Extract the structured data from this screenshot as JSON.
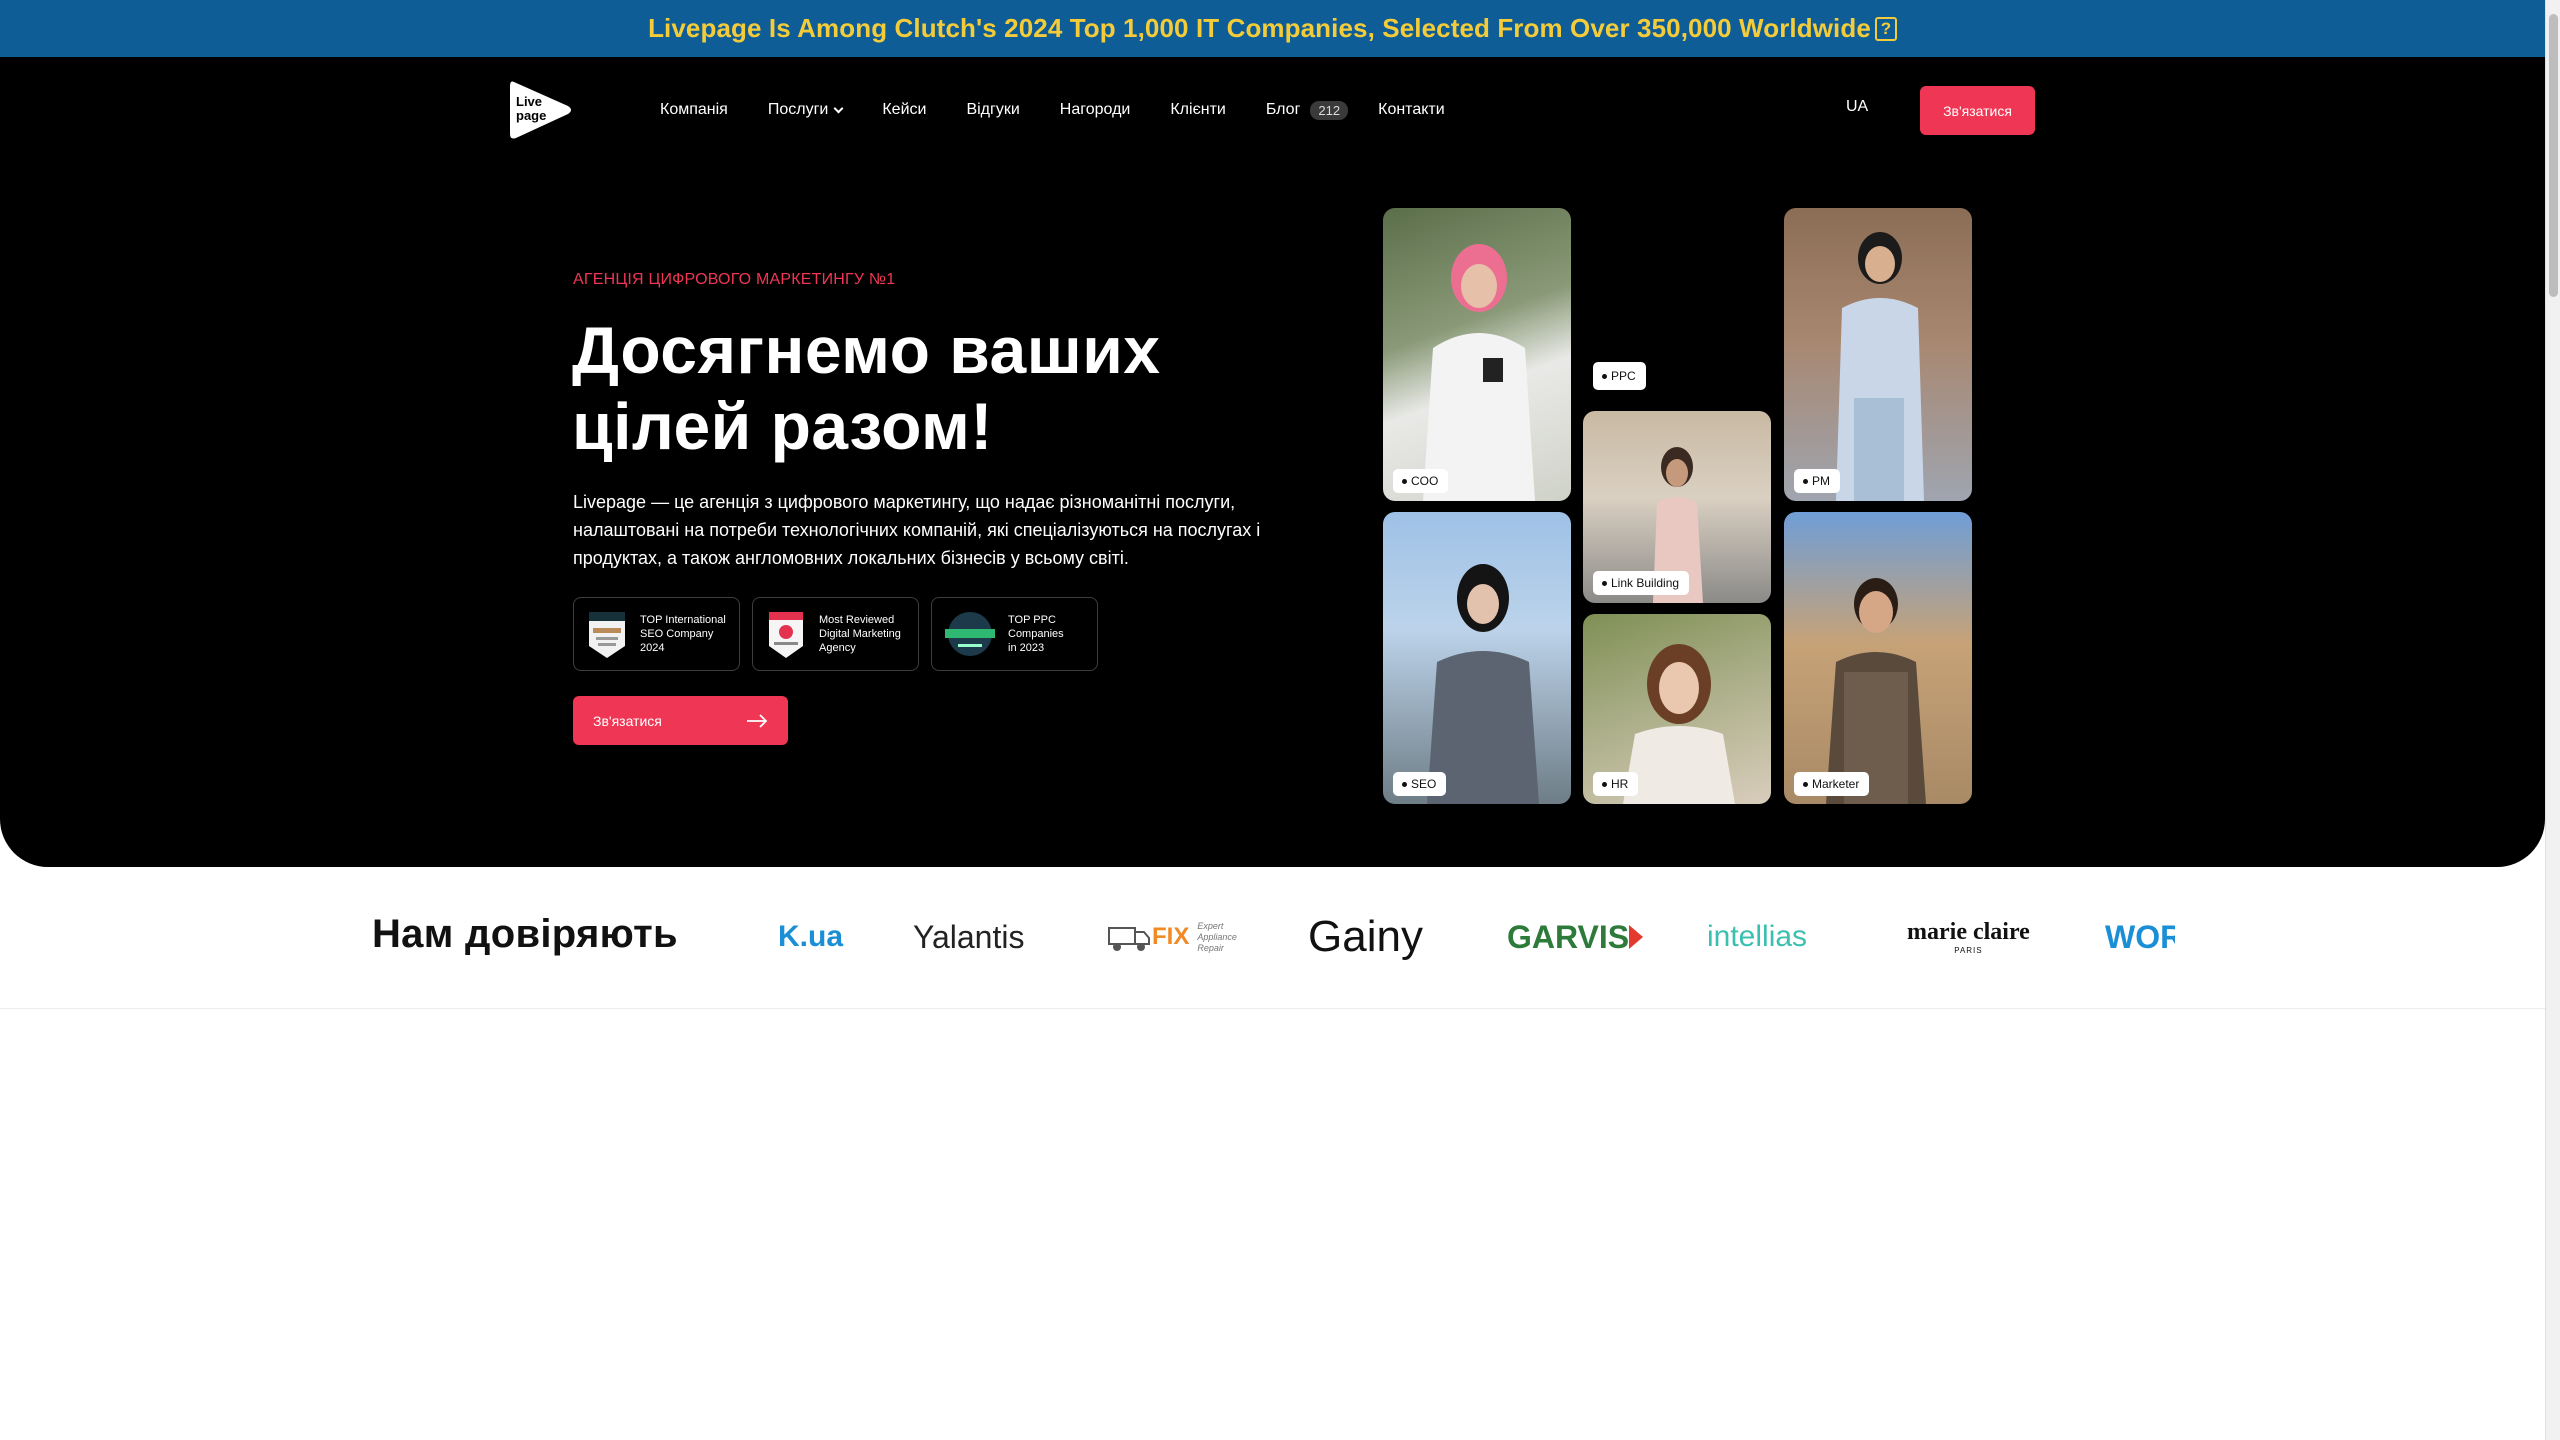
{
  "announcement": {
    "text": "Livepage Is Among Clutch's 2024 Top 1,000 IT Companies, Selected From Over 350,000 Worldwide",
    "q": "?"
  },
  "logo": {
    "line1": "Live",
    "line2": "page"
  },
  "nav": {
    "items": [
      {
        "label": "Компанія"
      },
      {
        "label": "Послуги"
      },
      {
        "label": "Кейси"
      },
      {
        "label": "Відгуки"
      },
      {
        "label": "Нагороди"
      },
      {
        "label": "Клієнти"
      },
      {
        "label": "Блог",
        "badge": "212"
      },
      {
        "label": "Контакти"
      }
    ]
  },
  "lang": "UA",
  "header_cta": "Зв'язатися",
  "hero": {
    "eyebrow": "АГЕНЦІЯ ЦИФРОВОГО МАРКЕТИНГУ №1",
    "headline": "Досягнемо ваших цілей разом!",
    "description": "Livepage — це агенція з цифрового маркетингу, що надає різноманітні послуги, налаштовані на потреби технологічних компаній, які спеціалізуються на послугах і продуктах, а також англомовних локальних бізнесів у всьому світі.",
    "badges": [
      {
        "line1": "TOP International",
        "line2": "SEO Company 2024",
        "line3": ""
      },
      {
        "line1": "Most Reviewed",
        "line2": "Digital Marketing",
        "line3": "Agency"
      },
      {
        "line1": "TOP PPC",
        "line2": "Companies",
        "line3": "in 2023"
      }
    ],
    "cta": "Зв'язатися"
  },
  "team": [
    {
      "role": "COO"
    },
    {
      "role": "PPC"
    },
    {
      "role": "PM"
    },
    {
      "role": "Link Building"
    },
    {
      "role": "SEO"
    },
    {
      "role": "HR"
    },
    {
      "role": "Marketer"
    }
  ],
  "trust": {
    "title": "Нам довіряють",
    "logos": [
      "K.ua",
      "Yalantis",
      "FIX",
      "Expert Appliance Repair",
      "Gainy",
      "GARVIS",
      "intellias",
      "marie claire",
      "PARIS",
      "WOR"
    ]
  },
  "colors": {
    "accent": "#ef3654",
    "announce_bg": "#0f5d96",
    "announce_text": "#f4cc3a"
  }
}
